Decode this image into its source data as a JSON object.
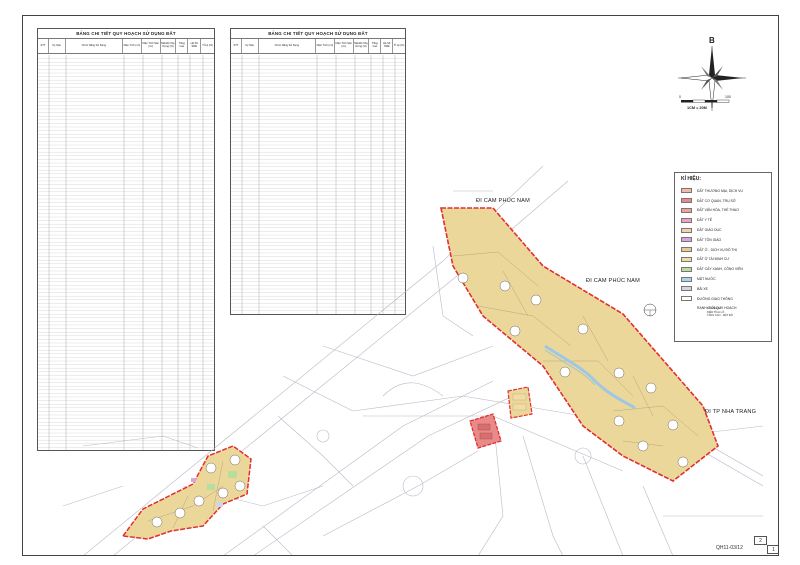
{
  "table_left": {
    "title": "BẢNG CHI TIẾT QUY HOẠCH SỬ DỤNG ĐẤT",
    "columns": [
      "STT",
      "Ký hiệu",
      "Chức Năng Sử Dụng",
      "Diện Tích (m²)",
      "Diện Tích Sàn (m²)",
      "Mật Độ Xây Dựng (%)",
      "Tầng Cao",
      "Hệ Số SDĐ",
      "Tỉ Lệ (%)"
    ]
  },
  "table_right": {
    "title": "BẢNG CHI TIẾT QUY HOẠCH SỬ DỤNG ĐẤT",
    "columns": [
      "STT",
      "Ký hiệu",
      "Chức Năng Sử Dụng",
      "Diện Tích (m²)",
      "Diện Tích Sàn (m²)",
      "Mật Độ Xây Dựng (%)",
      "Tầng Cao",
      "Hệ Số SDĐ",
      "Tỉ Lệ (%)"
    ]
  },
  "compass": {
    "north_label": "B",
    "scale_label": "1CM = 20M",
    "scale_start": "0",
    "scale_end": "100"
  },
  "legend": {
    "title": "KÍ HIỆU:",
    "items": [
      {
        "label": "ĐẤT THƯƠNG MẠI, DỊCH VỤ",
        "color": "#f4b9a8"
      },
      {
        "label": "ĐẤT CƠ QUAN, TRỤ SỞ",
        "color": "#e88a8a"
      },
      {
        "label": "ĐẤT VĂN HÓA, THỂ THAO",
        "color": "#f0a19a"
      },
      {
        "label": "ĐẤT Y TẾ",
        "color": "#f2a0c0"
      },
      {
        "label": "ĐẤT GIÁO DỤC",
        "color": "#f3d3a5"
      },
      {
        "label": "ĐẤT TÔN GIÁO",
        "color": "#d8a6d8"
      },
      {
        "label": "ĐẤT Ở - DỊCH VỤ ĐÔ THỊ",
        "color": "#ecc98f"
      },
      {
        "label": "ĐẤT Ở TÁI ĐỊNH CƯ",
        "color": "#f2dca6"
      },
      {
        "label": "ĐẤT CÂY XANH, CÔNG VIÊN",
        "color": "#b9dd9c"
      },
      {
        "label": "MẶT NƯỚC",
        "color": "#a9d3ef"
      },
      {
        "label": "BÃI XE",
        "color": "#cfd6e6"
      },
      {
        "label": "ĐƯỜNG GIAO THÔNG",
        "color": "#ffffff"
      },
      {
        "label": "RANH GIỚI QUY HOẠCH",
        "color": "#e03030"
      }
    ]
  },
  "legend_note": {
    "line1": "KÝ HIỆU LÔ",
    "line2": "DIỆN TÍCH LÔ",
    "line3": "TẦNG CAO - MẬT ĐỘ"
  },
  "roads": {
    "north_1": "ĐI CAM PHÚC NAM",
    "north_2": "ĐI CAM PHÚC NAM",
    "east": "ĐI TP NHA TRANG"
  },
  "sheet_code": "QH11-03/12",
  "pages": {
    "top": "2",
    "bottom": "1"
  },
  "colors": {
    "boundary": "#e03030",
    "residential": "#ecd79a",
    "water": "#9cc8e6",
    "road": "#b9b9c8"
  }
}
